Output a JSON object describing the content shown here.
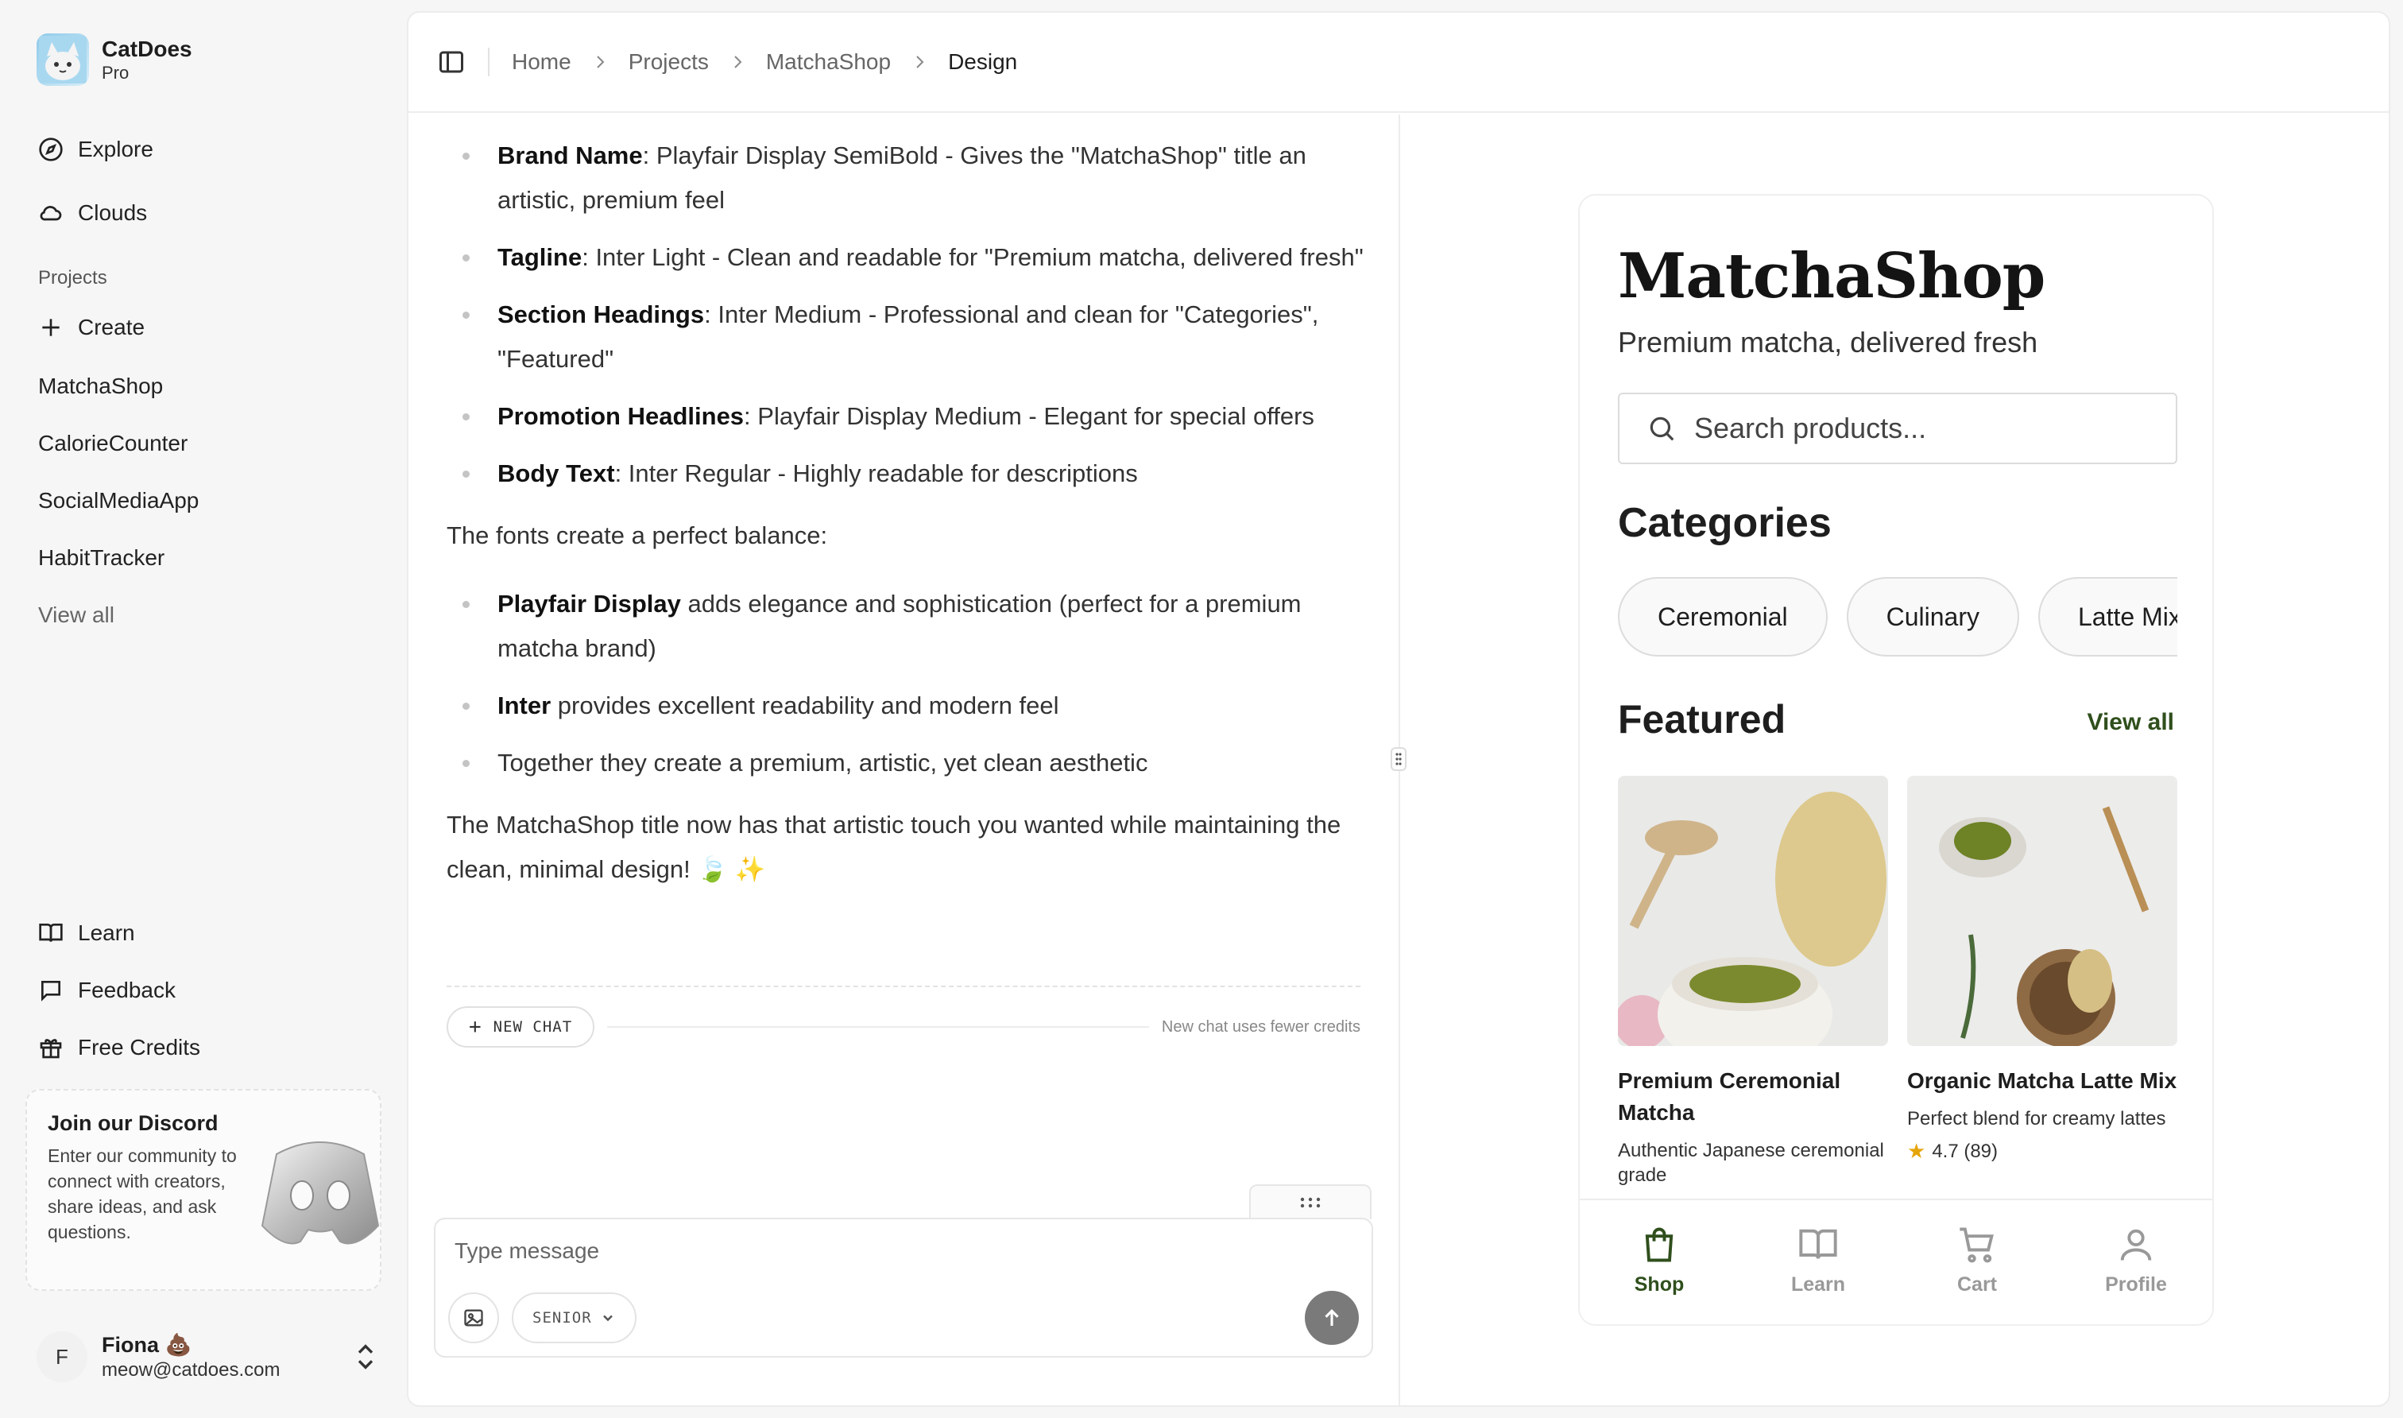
{
  "brand": {
    "name": "CatDoes",
    "plan": "Pro"
  },
  "sidebar": {
    "nav": [
      {
        "label": "Explore",
        "icon": "compass-icon"
      },
      {
        "label": "Clouds",
        "icon": "cloud-icon"
      }
    ],
    "projects_label": "Projects",
    "create_label": "Create",
    "projects": [
      "MatchaShop",
      "CalorieCounter",
      "SocialMediaApp",
      "HabitTracker"
    ],
    "view_all": "View all",
    "bottom": [
      {
        "label": "Learn",
        "icon": "book-icon"
      },
      {
        "label": "Feedback",
        "icon": "chat-bubble-icon"
      },
      {
        "label": "Free Credits",
        "icon": "gift-icon"
      }
    ],
    "discord": {
      "title": "Join our Discord",
      "desc": "Enter our community to connect with creators, share ideas, and ask questions."
    },
    "user": {
      "initial": "F",
      "name": "Fiona 💩",
      "email": "meow@catdoes.com"
    }
  },
  "breadcrumb": [
    "Home",
    "Projects",
    "MatchaShop",
    "Design"
  ],
  "chat": {
    "list1": [
      {
        "term": "Brand Name",
        "text": ": Playfair Display SemiBold - Gives the \"MatchaShop\" title an artistic, premium feel"
      },
      {
        "term": "Tagline",
        "text": ": Inter Light - Clean and readable for \"Premium matcha, delivered fresh\""
      },
      {
        "term": "Section Headings",
        "text": ": Inter Medium - Professional and clean for \"Categories\", \"Featured\""
      },
      {
        "term": "Promotion Headlines",
        "text": ": Playfair Display Medium - Elegant for special offers"
      },
      {
        "term": "Body Text",
        "text": ": Inter Regular - Highly readable for descriptions"
      }
    ],
    "para1": "The fonts create a perfect balance:",
    "list2": [
      {
        "term": "Playfair Display",
        "text": " adds elegance and sophistication (perfect for a premium matcha brand)"
      },
      {
        "term": "Inter",
        "text": " provides excellent readability and modern feel"
      },
      {
        "term": "",
        "text": "Together they create a premium, artistic, yet clean aesthetic"
      }
    ],
    "para2": "The MatchaShop title now has that artistic touch you wanted while maintaining the clean, minimal design! 🍃 ✨",
    "new_chat_label": "NEW CHAT",
    "new_chat_note": "New chat uses fewer credits",
    "composer_placeholder": "Type message",
    "mode_label": "SENIOR"
  },
  "preview": {
    "title": "MatchaShop",
    "tagline": "Premium matcha, delivered fresh",
    "search_placeholder": "Search products...",
    "categories_heading": "Categories",
    "categories": [
      "Ceremonial",
      "Culinary",
      "Latte Mix"
    ],
    "featured_heading": "Featured",
    "featured_viewall": "View all",
    "products": [
      {
        "name": "Premium Ceremonial Matcha",
        "desc": "Authentic Japanese ceremonial grade",
        "rating": ""
      },
      {
        "name": "Organic Matcha Latte Mix",
        "desc": "Perfect blend for creamy lattes",
        "rating": "4.7 (89)"
      }
    ],
    "tabs": [
      {
        "label": "Shop",
        "icon": "shopping-bag-icon",
        "active": true
      },
      {
        "label": "Learn",
        "icon": "open-book-icon",
        "active": false
      },
      {
        "label": "Cart",
        "icon": "cart-icon",
        "active": false
      },
      {
        "label": "Profile",
        "icon": "user-icon",
        "active": false
      }
    ],
    "accent_color": "#2f4f1c"
  }
}
